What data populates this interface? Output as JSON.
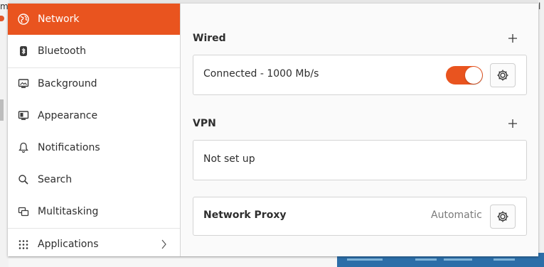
{
  "sidebar": {
    "items": [
      {
        "label": "Network",
        "icon": "network-globe-icon",
        "active": true
      },
      {
        "label": "Bluetooth",
        "icon": "bluetooth-icon"
      },
      {
        "label": "Background",
        "icon": "background-monitor-icon"
      },
      {
        "label": "Appearance",
        "icon": "appearance-icon"
      },
      {
        "label": "Notifications",
        "icon": "bell-icon"
      },
      {
        "label": "Search",
        "icon": "search-icon"
      },
      {
        "label": "Multitasking",
        "icon": "multitasking-icon"
      },
      {
        "label": "Applications",
        "icon": "apps-grid-icon",
        "has_submenu": true
      }
    ]
  },
  "wired": {
    "title": "Wired",
    "connection_label": "Connected - 1000 Mb/s",
    "toggle_on": true
  },
  "vpn": {
    "title": "VPN",
    "empty_label": "Not set up"
  },
  "proxy": {
    "label": "Network Proxy",
    "status": "Automatic"
  },
  "colors": {
    "accent": "#e9541f",
    "sidebar_bg": "#ffffff",
    "content_bg": "#fafafa"
  },
  "background": {
    "left_edge_text": "m",
    "right_edge_text": "l"
  }
}
